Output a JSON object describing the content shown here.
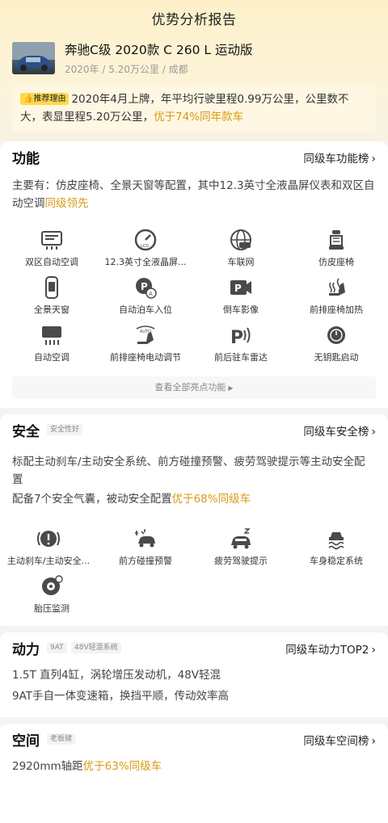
{
  "header": {
    "title": "优势分析报告"
  },
  "car": {
    "name": "奔驰C级 2020款 C 260 L 运动版",
    "meta": "2020年 / 5.20万公里 / 成都"
  },
  "reason": {
    "badge": "推荐理由",
    "text": "2020年4月上牌，年平均行驶里程0.99万公里，公里数不大，表显里程5.20万公里，",
    "highlight": "优于74%同年款车"
  },
  "features": {
    "title": "功能",
    "link": "同级车功能榜",
    "desc": "主要有：仿皮座椅、全景天窗等配置，其中12.3英寸全液晶屏仪表和双区自动空调",
    "desc_highlight": "同级领先",
    "items": [
      {
        "label": "双区自动空调",
        "icon": "dual-ac-icon"
      },
      {
        "label": "12.3英寸全液晶屏...",
        "icon": "lcd-gauge-icon"
      },
      {
        "label": "车联网",
        "icon": "connected-car-icon"
      },
      {
        "label": "仿皮座椅",
        "icon": "leather-seat-icon"
      },
      {
        "label": "全景天窗",
        "icon": "panoramic-roof-icon"
      },
      {
        "label": "自动泊车入位",
        "icon": "auto-park-icon"
      },
      {
        "label": "倒车影像",
        "icon": "reverse-camera-icon"
      },
      {
        "label": "前排座椅加热",
        "icon": "seat-heat-icon"
      },
      {
        "label": "自动空调",
        "icon": "auto-ac-icon"
      },
      {
        "label": "前排座椅电动调节",
        "icon": "power-seat-icon"
      },
      {
        "label": "前后驻车雷达",
        "icon": "parking-radar-icon"
      },
      {
        "label": "无钥匙启动",
        "icon": "keyless-start-icon"
      }
    ],
    "more": "查看全部亮点功能"
  },
  "safety": {
    "title": "安全",
    "tag": "安全性好",
    "link": "同级车安全榜",
    "desc1": "标配主动刹车/主动安全系统、前方碰撞预警、疲劳驾驶提示等主动安全配置",
    "desc2": "配备7个安全气囊，被动安全配置",
    "desc2_highlight": "优于68%同级车",
    "items": [
      {
        "label": "主动刹车/主动安全...",
        "icon": "active-brake-icon"
      },
      {
        "label": "前方碰撞预警",
        "icon": "collision-warning-icon"
      },
      {
        "label": "疲劳驾驶提示",
        "icon": "fatigue-alert-icon"
      },
      {
        "label": "车身稳定系统",
        "icon": "stability-control-icon"
      },
      {
        "label": "胎压监测",
        "icon": "tire-pressure-icon"
      }
    ]
  },
  "power": {
    "title": "动力",
    "tag1": "9AT",
    "tag2": "48V轻混系统",
    "link": "同级车动力TOP2",
    "desc1": "1.5T 直列4缸，涡轮增压发动机，48V轻混",
    "desc2": "9AT手自一体变速箱，换挡平顺，传动效率高"
  },
  "space": {
    "title": "空间",
    "tag": "老板键",
    "link": "同级车空间榜",
    "desc": "2920mm轴距",
    "desc_highlight": "优于63%同级车"
  },
  "colors": {
    "accent": "#d99a14",
    "badge": "#ffd84d",
    "icon": "#4a4a4a"
  }
}
